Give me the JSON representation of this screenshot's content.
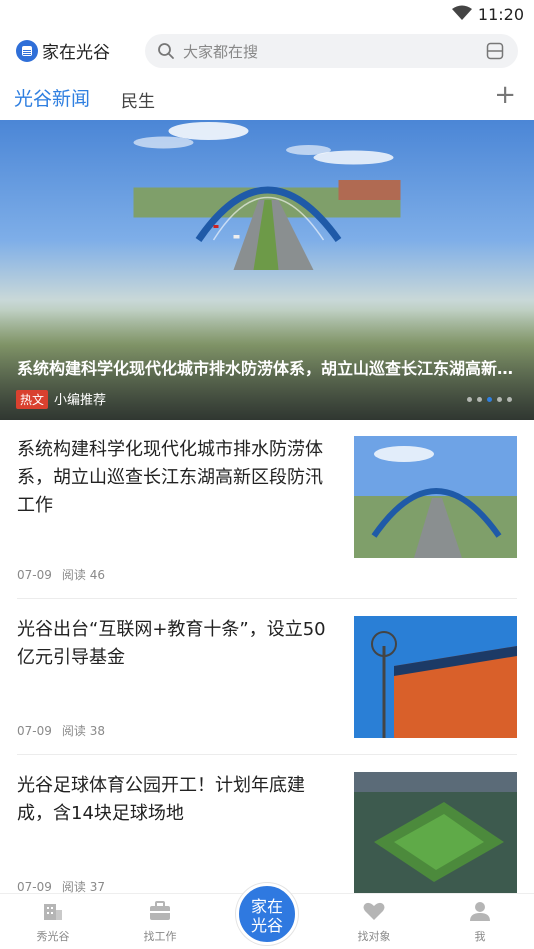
{
  "status_bar": {
    "time": "11:20"
  },
  "header": {
    "logo_text": "家在光谷",
    "search_placeholder": "大家都在搜"
  },
  "tabs": [
    {
      "label": "光谷新闻",
      "active": true
    },
    {
      "label": "民生",
      "active": false
    }
  ],
  "add_tab_label": "+",
  "banner": {
    "title": "系统构建科学化现代化城市排水防涝体系，胡立山巡查长江东湖高新区段防汛工作",
    "tag_hot": "热文",
    "tag_source": "小编推荐"
  },
  "news": [
    {
      "title": "系统构建科学化现代化城市排水防涝体系，胡立山巡查长江东湖高新区段防汛工作",
      "date": "07-09",
      "reads": "阅读 46"
    },
    {
      "title": "光谷出台“互联网+教育十条”，设立50亿元引导基金",
      "date": "07-09",
      "reads": "阅读 38"
    },
    {
      "title": "光谷足球体育公园开工！计划年底建成，含14块足球场地",
      "date": "07-09",
      "reads": "阅读 37"
    }
  ],
  "tabbar": {
    "items": [
      {
        "label": "秀光谷",
        "icon": "building-icon"
      },
      {
        "label": "找工作",
        "icon": "briefcase-icon"
      },
      {
        "label": "找对象",
        "icon": "heart-icon"
      },
      {
        "label": "我",
        "icon": "user-icon"
      }
    ],
    "center_label": "家在光谷"
  },
  "colors": {
    "accent": "#2f7fe0",
    "hot_tag": "#d9412f"
  }
}
